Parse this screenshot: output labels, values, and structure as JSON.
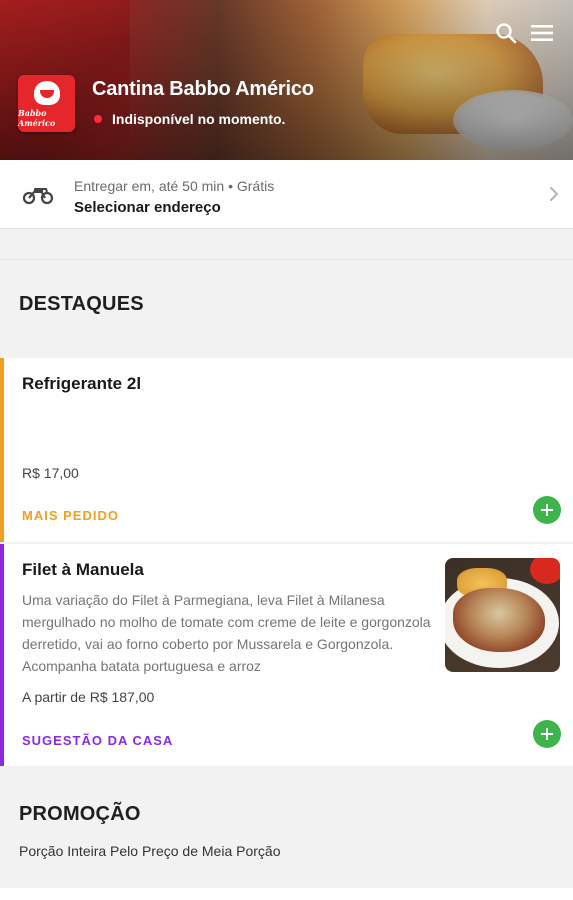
{
  "header": {
    "store_name": "Cantina Babbo Américo",
    "status": "Indisponível no momento.",
    "logo_text": "Babbo Américo",
    "icons": {
      "search": "search-icon",
      "menu": "menu-icon"
    }
  },
  "delivery": {
    "line1": "Entregar em, até 50 min • Grátis",
    "line2": "Selecionar endereço",
    "icon": "motorcycle-icon"
  },
  "highlights": {
    "title": "DESTAQUES",
    "items": [
      {
        "name": "Refrigerante 2l",
        "price": "R$ 17,00",
        "tag": "MAIS PEDIDO",
        "tag_color": "#f0a020"
      },
      {
        "name": "Filet à Manuela",
        "description": "Uma variação do Filet à Parmegiana, leva Filet à Milanesa mergulhado no molho de tomate com creme de leite e gorgonzola derretido, vai ao forno coberto por Mussarela e Gorgonzola. Acompanha batata portuguesa e arroz",
        "price": "A partir de R$ 187,00",
        "tag": "SUGESTÃO DA CASA",
        "tag_color": "#8a2be2"
      }
    ]
  },
  "promo": {
    "title": "PROMOÇÃO",
    "subtitle": "Porção Inteira Pelo Preço de Meia Porção"
  },
  "colors": {
    "add_button": "#3db54a",
    "status_dot": "#ff2b3d",
    "brand_red": "#e5262a"
  }
}
